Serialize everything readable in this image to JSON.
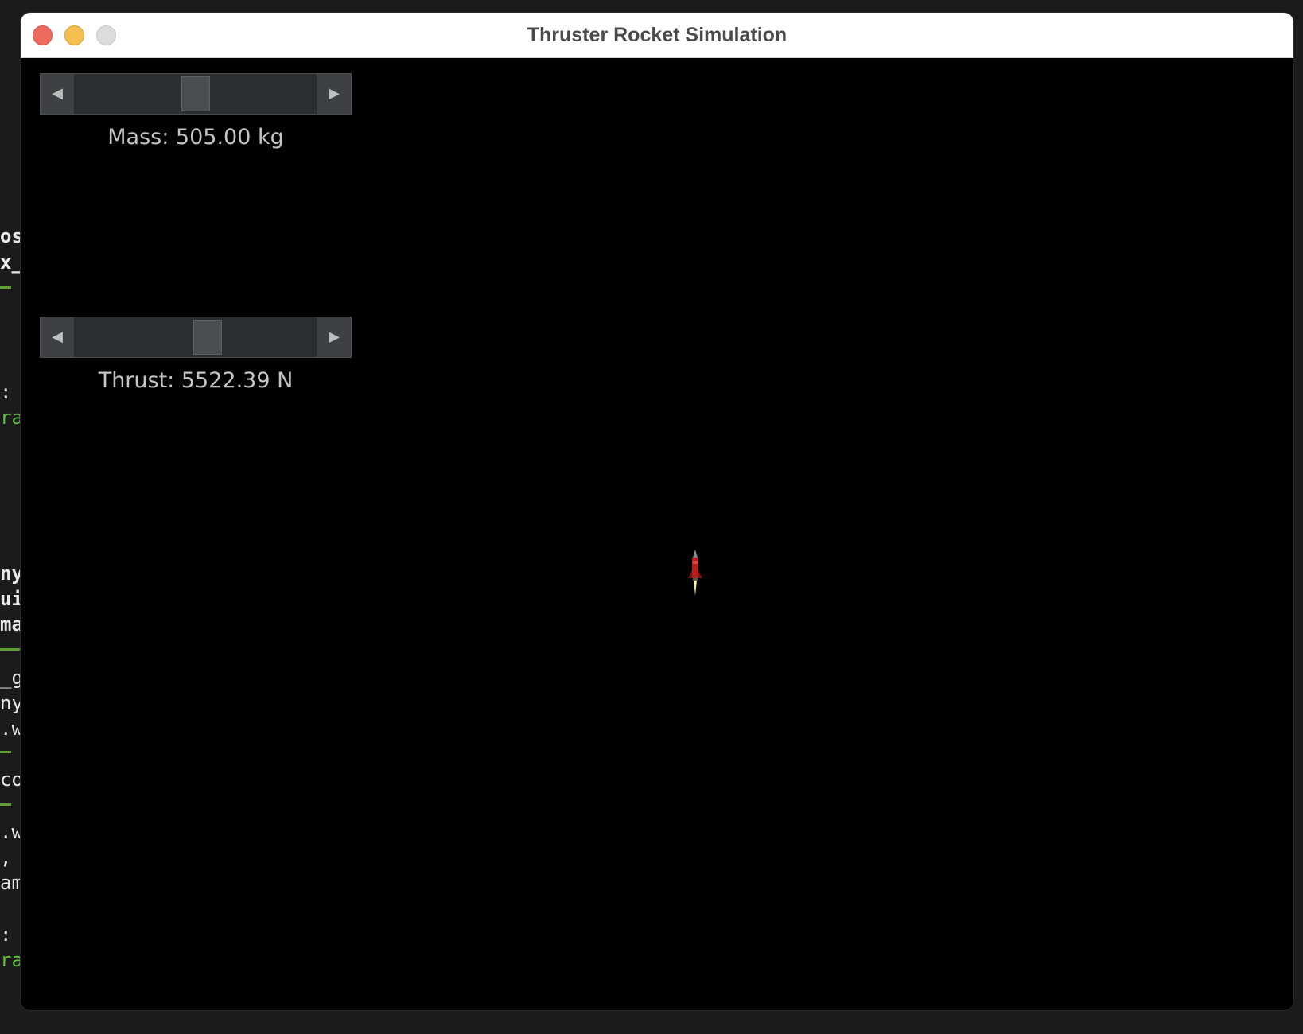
{
  "window": {
    "title": "Thruster Rocket Simulation"
  },
  "sliders": {
    "mass": {
      "label": "Mass: 505.00 kg",
      "value_fraction": 0.5
    },
    "thrust": {
      "label": "Thrust: 5522.39 N",
      "value_fraction": 0.55
    }
  },
  "icons": {
    "scroll_left": "◀",
    "scroll_right": "▶"
  },
  "background_terminal": {
    "fragments": [
      "os",
      "x_",
      ":",
      "ra",
      "ny",
      "ui",
      "ma",
      "_g",
      "ny",
      ".w",
      "co",
      ".w",
      ",",
      "am",
      ":",
      "rad"
    ]
  },
  "colors": {
    "close": "#ed6a5e",
    "minimize": "#f5bf4f",
    "zoom": "#dcdcdc",
    "canvas": "#000000",
    "rocket_body": "#b32020",
    "flame": "#f5e34a"
  }
}
